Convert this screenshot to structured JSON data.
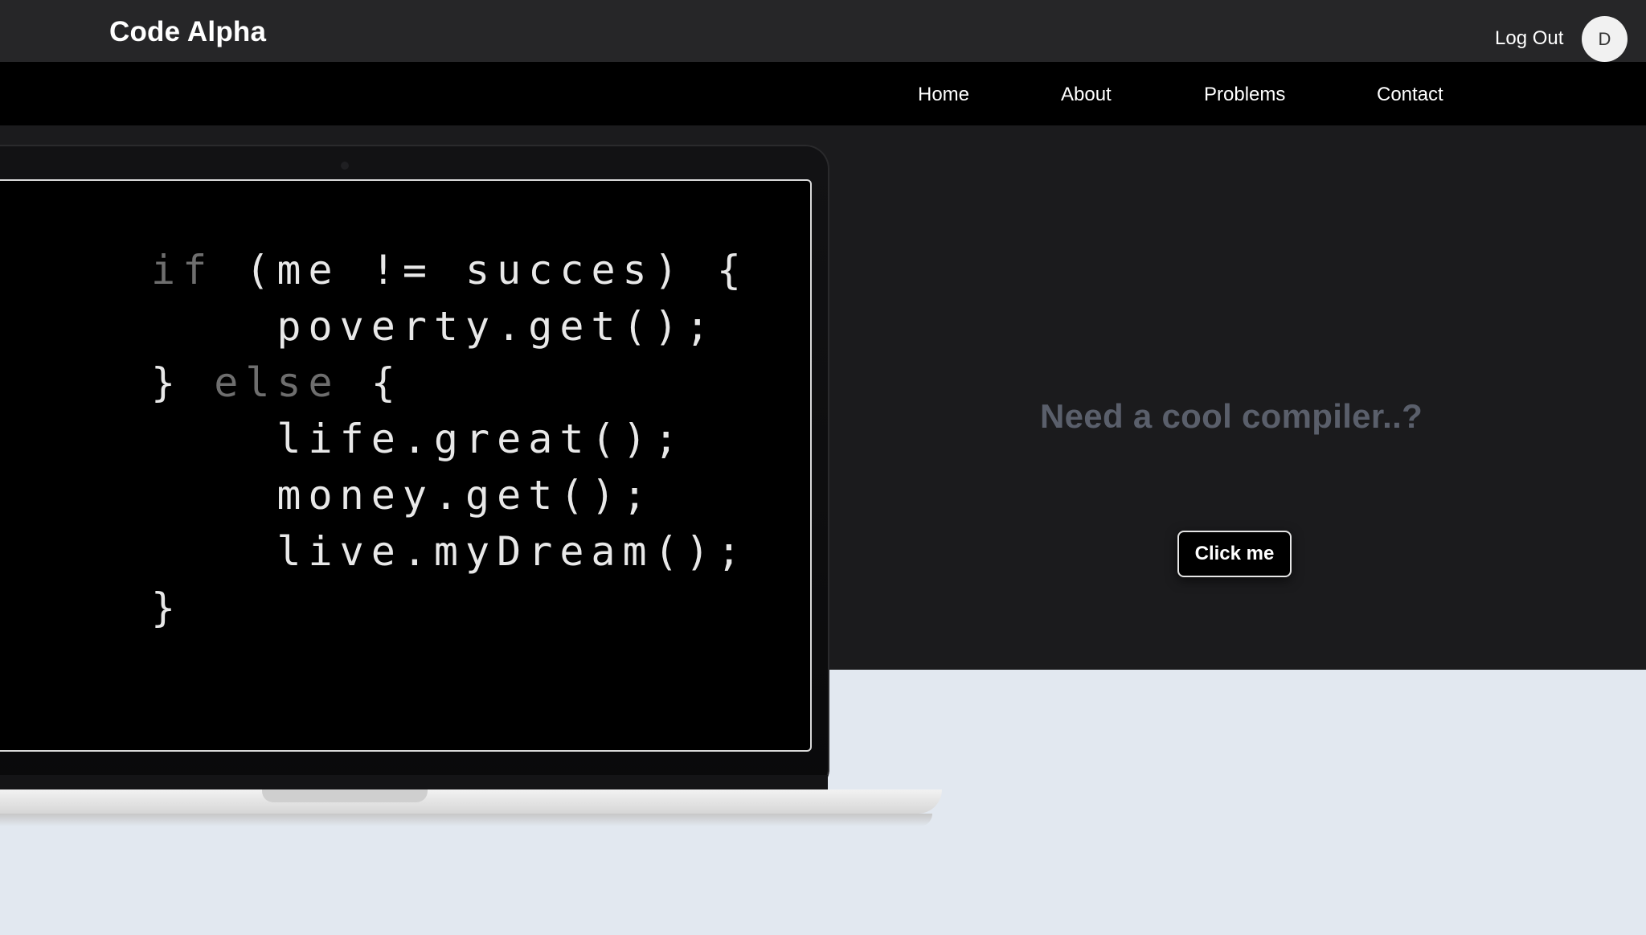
{
  "header": {
    "brand": "Code Alpha",
    "logout_label": "Log Out",
    "avatar_initial": "D"
  },
  "nav": {
    "items": [
      "Home",
      "About",
      "Problems",
      "Contact"
    ]
  },
  "hero": {
    "code_lines": [
      [
        "if",
        " (me != succes) {"
      ],
      [
        "",
        "    poverty.get();"
      ],
      [
        "",
        "} "
      ],
      [
        "",
        "    life.great();"
      ],
      [
        "",
        "    money.get();"
      ],
      [
        "",
        "    live.myDream();"
      ],
      [
        "",
        "}"
      ]
    ],
    "else_keyword": "else",
    "else_tail": " {",
    "headline": "Need a cool compiler..?",
    "button_label": "Click me"
  },
  "colors": {
    "topbar": "#262628",
    "navbar": "#000000",
    "hero_bg": "#1b1b1d",
    "page_bg": "#e2e8f0",
    "headline": "#5a5f6b"
  }
}
